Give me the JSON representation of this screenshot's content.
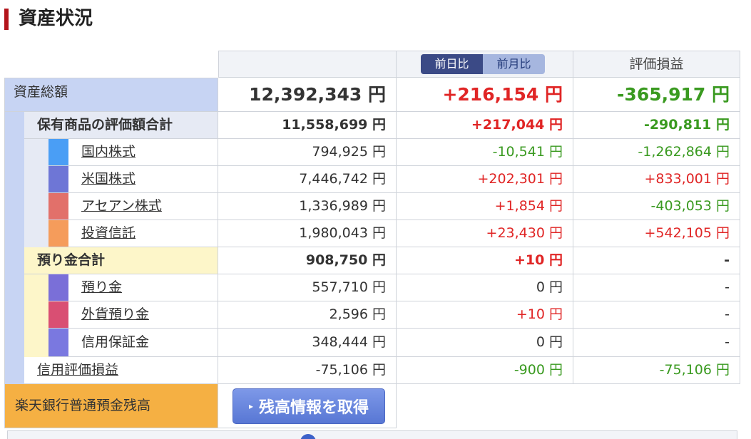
{
  "page_title": "資産状況",
  "header": {
    "toggle_daily": "前日比",
    "toggle_monthly": "前月比",
    "eval_pl": "評価損益"
  },
  "total": {
    "label": "資産総額",
    "amount": "12,392,343 円",
    "change": "+216,154 円",
    "pl": "-365,917 円"
  },
  "holdings": {
    "label": "保有商品の評価額合計",
    "amount": "11,558,699 円",
    "change": "+217,044 円",
    "pl": "-290,811 円",
    "items": [
      {
        "label": "国内株式",
        "amount": "794,925 円",
        "change": "-10,541 円",
        "pl": "-1,262,864 円",
        "color": "#4a9ef5"
      },
      {
        "label": "米国株式",
        "amount": "7,446,742 円",
        "change": "+202,301 円",
        "pl": "+833,001 円",
        "color": "#6e76d6"
      },
      {
        "label": "アセアン株式",
        "amount": "1,336,989 円",
        "change": "+1,854 円",
        "pl": "-403,053 円",
        "color": "#e2706a"
      },
      {
        "label": "投資信託",
        "amount": "1,980,043 円",
        "change": "+23,430 円",
        "pl": "+542,105 円",
        "color": "#f59c5b"
      }
    ]
  },
  "deposits": {
    "label": "預り金合計",
    "amount": "908,750 円",
    "change": "+10 円",
    "pl": "-",
    "items": [
      {
        "label": "預り金",
        "amount": "557,710 円",
        "change": "0 円",
        "pl": "-",
        "color": "#7a6fd8"
      },
      {
        "label": "外貨預り金",
        "amount": "2,596 円",
        "change": "+10 円",
        "pl": "-",
        "color": "#d94f73"
      },
      {
        "label": "信用保証金",
        "amount": "348,444 円",
        "change": "0 円",
        "pl": "-",
        "color": "#7a78e0"
      }
    ]
  },
  "margin": {
    "label": "信用評価損益",
    "amount": "-75,106 円",
    "change": "-900 円",
    "pl": "-75,106 円"
  },
  "bank": {
    "label": "楽天銀行普通預金残高",
    "button": "残高情報を取得"
  },
  "colors": {
    "accent": "#b3141b",
    "positive": "#e02525",
    "negative": "#3a9a20",
    "total_band": "#c7d4f3",
    "deposit_band": "#fdf6c9",
    "bank_band": "#f5b043"
  }
}
